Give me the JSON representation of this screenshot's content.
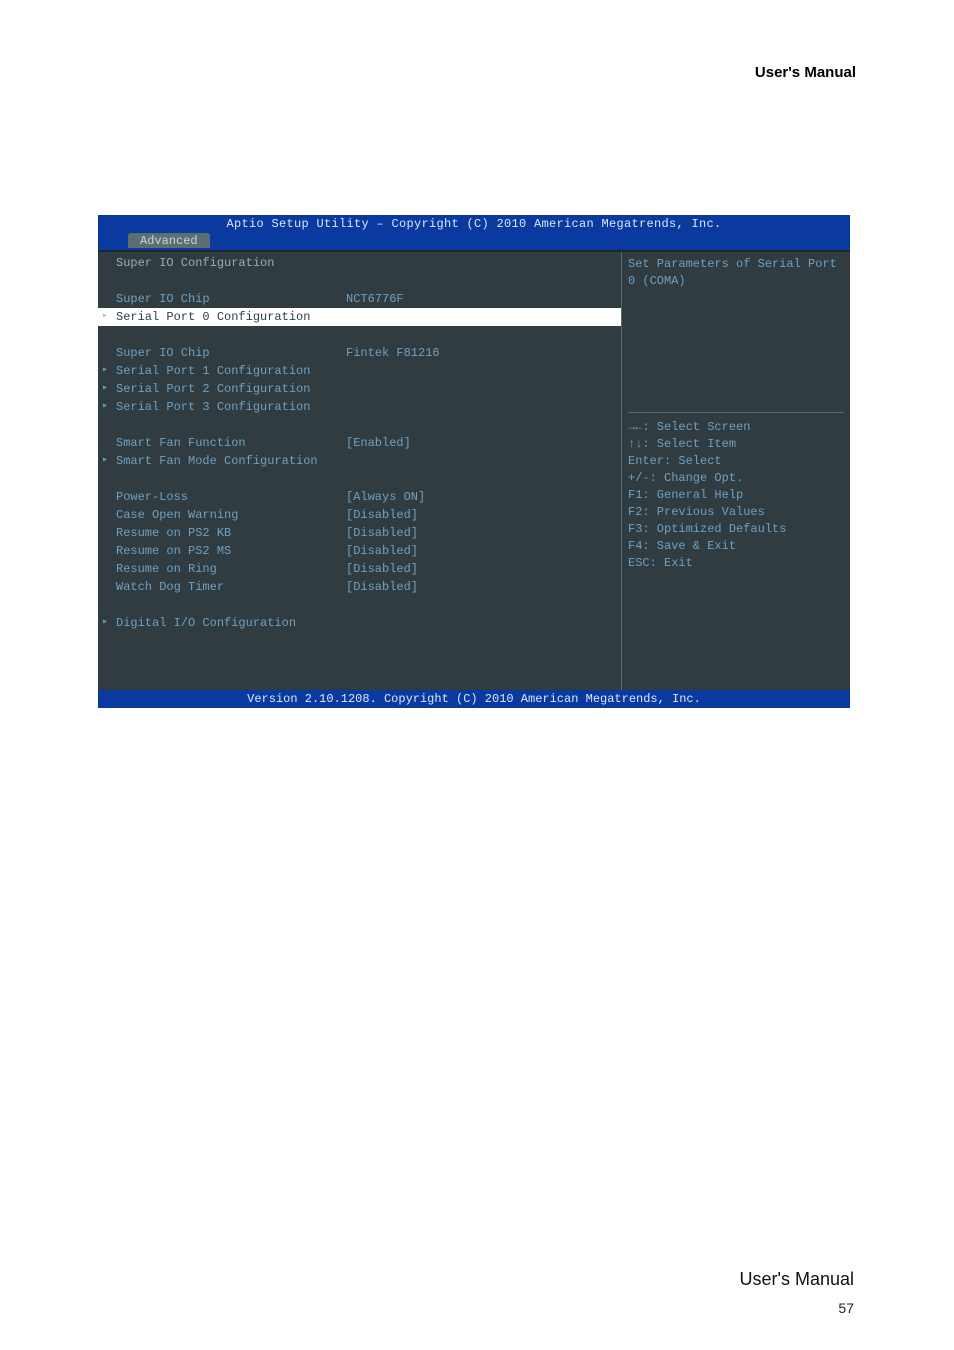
{
  "header_label": "User's  Manual",
  "bios": {
    "title": "Aptio Setup Utility – Copyright (C) 2010 American Megatrends, Inc.",
    "tab": "Advanced",
    "section_header": "Super IO Configuration",
    "rows": [
      {
        "label": "Super IO Chip",
        "value": "NCT6776F",
        "type": "info"
      },
      {
        "label": "Serial Port 0 Configuration",
        "value": "",
        "type": "submenu",
        "selected": true
      },
      {
        "type": "spacer"
      },
      {
        "label": "Super IO Chip",
        "value": "Fintek F81216",
        "type": "info"
      },
      {
        "label": "Serial Port 1 Configuration",
        "value": "",
        "type": "submenu"
      },
      {
        "label": "Serial Port 2 Configuration",
        "value": "",
        "type": "submenu"
      },
      {
        "label": "Serial Port 3 Configuration",
        "value": "",
        "type": "submenu"
      },
      {
        "type": "spacer"
      },
      {
        "label": "Smart Fan Function",
        "value": "[Enabled]",
        "type": "option"
      },
      {
        "label": "Smart Fan Mode Configuration",
        "value": "",
        "type": "submenu"
      },
      {
        "type": "spacer"
      },
      {
        "label": "Power-Loss",
        "value": "[Always ON]",
        "type": "option"
      },
      {
        "label": "Case Open Warning",
        "value": "[Disabled]",
        "type": "option"
      },
      {
        "label": "Resume on PS2 KB",
        "value": "[Disabled]",
        "type": "option"
      },
      {
        "label": "Resume on PS2 MS",
        "value": "[Disabled]",
        "type": "option"
      },
      {
        "label": "Resume on Ring",
        "value": "[Disabled]",
        "type": "option"
      },
      {
        "label": "Watch Dog Timer",
        "value": "[Disabled]",
        "type": "option"
      },
      {
        "type": "spacer"
      },
      {
        "label": "Digital I/O Configuration",
        "value": "",
        "type": "submenu"
      }
    ],
    "help_text": "Set Parameters of Serial Port 0 (COMA)",
    "keys": [
      "→←: Select Screen",
      "↑↓: Select Item",
      "Enter: Select",
      "+/-: Change Opt.",
      "F1: General Help",
      "F2: Previous Values",
      "F3: Optimized Defaults",
      "F4: Save & Exit",
      "ESC: Exit"
    ],
    "footer": "Version 2.10.1208. Copyright (C) 2010 American Megatrends, Inc."
  },
  "doc_footer": "User's  Manual",
  "doc_pagenum": "57"
}
